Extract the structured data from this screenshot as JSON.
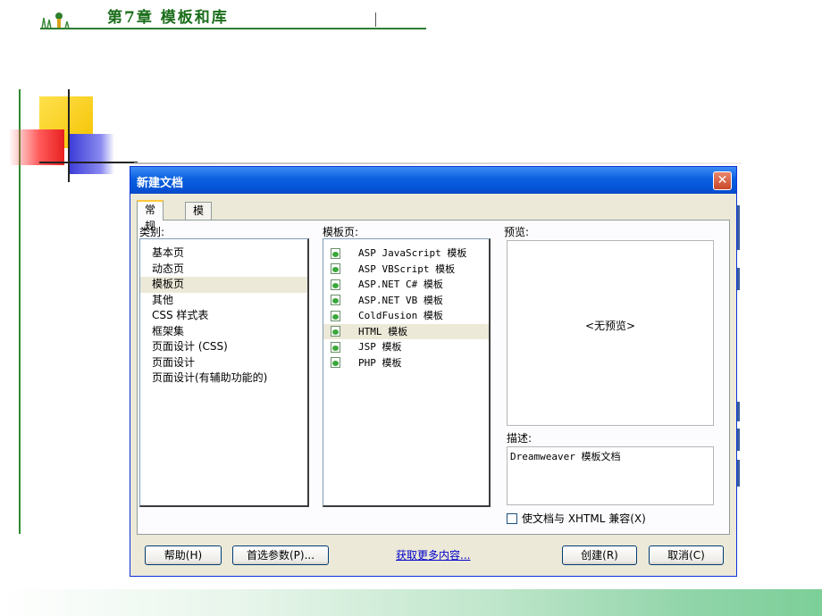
{
  "slide": {
    "title": "第7章  模板和库"
  },
  "dialog": {
    "title": "新建文档",
    "close_label": "✕",
    "tabs": [
      {
        "label": "常规"
      },
      {
        "label": "模板"
      }
    ],
    "category_label": "类别:",
    "categories": [
      {
        "label": "基本页"
      },
      {
        "label": "动态页"
      },
      {
        "label": "模板页"
      },
      {
        "label": "其他"
      },
      {
        "label": "CSS 样式表"
      },
      {
        "label": "框架集"
      },
      {
        "label": "页面设计 (CSS)"
      },
      {
        "label": "页面设计"
      },
      {
        "label": "页面设计(有辅助功能的)"
      }
    ],
    "selected_category": "模板页",
    "template_label": "模板页:",
    "templates": [
      {
        "label": "ASP JavaScript 模板"
      },
      {
        "label": "ASP VBScript 模板"
      },
      {
        "label": "ASP.NET C# 模板"
      },
      {
        "label": "ASP.NET VB 模板"
      },
      {
        "label": "ColdFusion 模板"
      },
      {
        "label": "HTML 模板"
      },
      {
        "label": "JSP 模板"
      },
      {
        "label": "PHP 模板"
      }
    ],
    "selected_template": "HTML 模板",
    "preview_label": "预览:",
    "no_preview": "<无预览>",
    "description_label": "描述:",
    "description": "Dreamweaver 模板文档",
    "xhtml_checkbox_label": "使文档与 XHTML 兼容(X)",
    "xhtml_checked": false,
    "buttons": {
      "help": "帮助(H)",
      "preferences": "首选参数(P)...",
      "more_content": "获取更多内容...",
      "create": "创建(R)",
      "cancel": "取消(C)"
    },
    "icons": {
      "template_item": "dreamweaver-template-icon",
      "close": "close-icon"
    }
  }
}
